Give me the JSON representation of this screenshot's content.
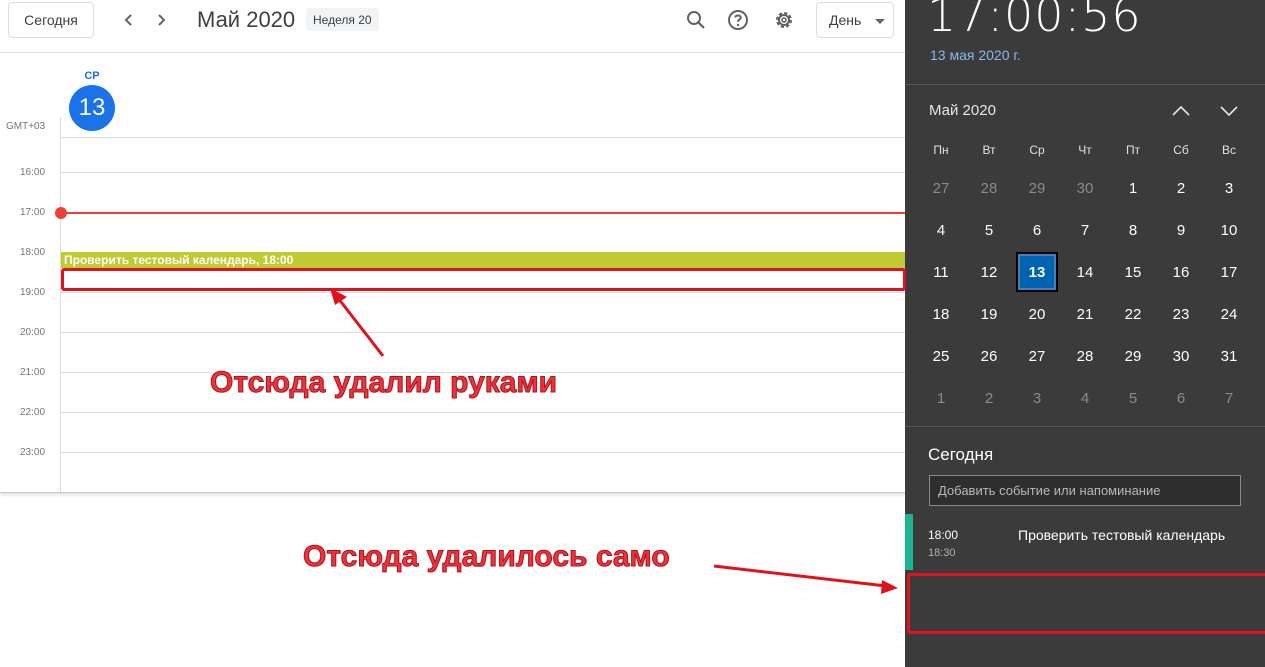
{
  "gcal": {
    "today_button": "Сегодня",
    "month_title": "Май 2020",
    "week_chip": "Неделя 20",
    "view_select": "День",
    "day_name": "СР",
    "day_number": "13",
    "timezone": "GMT+03",
    "hours": [
      "16:00",
      "17:00",
      "18:00",
      "19:00",
      "20:00",
      "21:00",
      "22:00",
      "23:00"
    ],
    "event_label": "Проверить тестовый календарь, 18:00",
    "event_color": "#c0ca33",
    "current_time_color": "#ea4335",
    "accent_color": "#1a73e8"
  },
  "flyout": {
    "clock": "17:00:56",
    "date_link": "13 мая 2020 г.",
    "month_label": "Май 2020",
    "weekdays": [
      "Пн",
      "Вт",
      "Ср",
      "Чт",
      "Пт",
      "Сб",
      "Вс"
    ],
    "days": [
      {
        "n": "27",
        "dim": true
      },
      {
        "n": "28",
        "dim": true
      },
      {
        "n": "29",
        "dim": true
      },
      {
        "n": "30",
        "dim": true
      },
      {
        "n": "1"
      },
      {
        "n": "2"
      },
      {
        "n": "3"
      },
      {
        "n": "4"
      },
      {
        "n": "5"
      },
      {
        "n": "6"
      },
      {
        "n": "7"
      },
      {
        "n": "8"
      },
      {
        "n": "9"
      },
      {
        "n": "10"
      },
      {
        "n": "11"
      },
      {
        "n": "12"
      },
      {
        "n": "13",
        "today": true
      },
      {
        "n": "14"
      },
      {
        "n": "15"
      },
      {
        "n": "16"
      },
      {
        "n": "17"
      },
      {
        "n": "18"
      },
      {
        "n": "19"
      },
      {
        "n": "20"
      },
      {
        "n": "21"
      },
      {
        "n": "22"
      },
      {
        "n": "23"
      },
      {
        "n": "24"
      },
      {
        "n": "25"
      },
      {
        "n": "26"
      },
      {
        "n": "27"
      },
      {
        "n": "28"
      },
      {
        "n": "29"
      },
      {
        "n": "30"
      },
      {
        "n": "31"
      },
      {
        "n": "1",
        "dim": true
      },
      {
        "n": "2",
        "dim": true
      },
      {
        "n": "3",
        "dim": true
      },
      {
        "n": "4",
        "dim": true
      },
      {
        "n": "5",
        "dim": true
      },
      {
        "n": "6",
        "dim": true
      },
      {
        "n": "7",
        "dim": true
      }
    ],
    "today_heading": "Сегодня",
    "add_placeholder": "Добавить событие или напоминание",
    "event": {
      "start": "18:00",
      "end": "18:30",
      "title": "Проверить тестовый календарь",
      "accent_color": "#1ab394"
    },
    "today_highlight_color": "#0063b1"
  },
  "annotations": {
    "manual_delete": "Отсюда удалил руками",
    "auto_delete": "Отсюда удалилось само",
    "color": "#e0121b"
  }
}
